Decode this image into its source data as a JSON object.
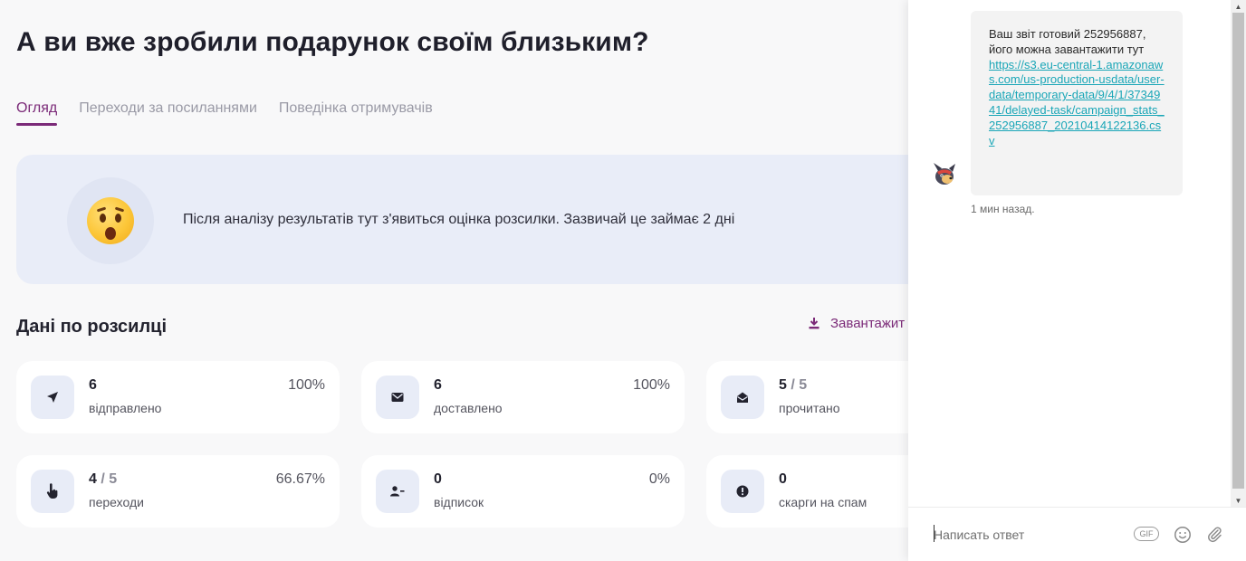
{
  "main": {
    "title": "А ви вже зробили подарунок своїм близьким?",
    "tabs": [
      {
        "label": "Огляд",
        "active": true
      },
      {
        "label": "Переходи за посиланнями",
        "active": false
      },
      {
        "label": "Поведінка отримувачів",
        "active": false
      }
    ],
    "banner": {
      "emoji": "hushed-face-icon",
      "text": "Після аналізу результатів тут з'явиться оцінка розсилки. Зазвичай це займає 2 дні"
    },
    "section_title": "Дані по розсилці",
    "download_label": "Завантажит",
    "stats": [
      {
        "icon": "send-icon",
        "value": "6",
        "total": "",
        "label": "відправлено",
        "pct": "100%"
      },
      {
        "icon": "envelope-icon",
        "value": "6",
        "total": "",
        "label": "доставлено",
        "pct": "100%"
      },
      {
        "icon": "open-envelope-icon",
        "value": "5",
        "total": " / 5",
        "label": "прочитано",
        "pct": ""
      },
      {
        "icon": "pointer-hand-icon",
        "value": "4",
        "total": " / 5",
        "label": "переходи",
        "pct": "66.67%"
      },
      {
        "icon": "remove-user-icon",
        "value": "0",
        "total": "",
        "label": "відписок",
        "pct": "0%"
      },
      {
        "icon": "alert-icon",
        "value": "0",
        "total": "",
        "label": "скарги на спам",
        "pct": ""
      }
    ]
  },
  "chat": {
    "message_text": "Ваш звіт готовий 252956887, його можна завантажити тут",
    "message_link": "https://s3.eu-central-1.amazonaws.com/us-production-usdata/user-data/temporary-data/9/4/1/3734941/delayed-task/campaign_stats_252956887_20210414122136.csv",
    "timestamp": "1 мин назад.",
    "composer_placeholder": "Написать ответ",
    "gif_label": "GIF"
  },
  "colors": {
    "accent": "#7b2a78",
    "link": "#1aa6b7",
    "banner_bg": "#e9edf8",
    "icon_bg": "#e8ecf7",
    "page_bg": "#f8f8f9"
  }
}
